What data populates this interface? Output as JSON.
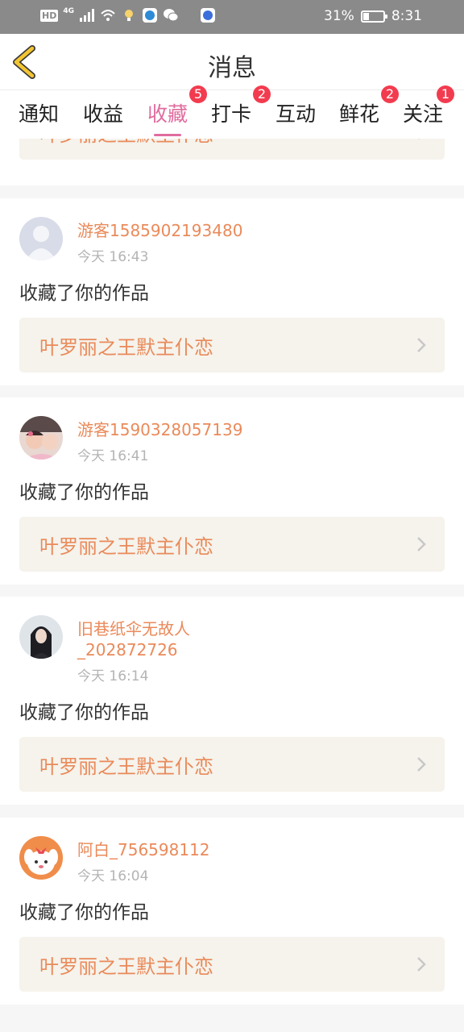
{
  "status_bar": {
    "network_badge": "HD",
    "signal": "4G",
    "battery": "31%",
    "battery_level": 0.31,
    "time": "8:31"
  },
  "header": {
    "title": "消息",
    "back_icon": "chevron-left-icon"
  },
  "tabs": [
    {
      "label": "通知",
      "badge": ""
    },
    {
      "label": "收益",
      "badge": ""
    },
    {
      "label": "收藏",
      "badge": "5",
      "active": true
    },
    {
      "label": "打卡",
      "badge": "2"
    },
    {
      "label": "互动",
      "badge": ""
    },
    {
      "label": "鲜花",
      "badge": "2"
    },
    {
      "label": "关注",
      "badge": "1"
    }
  ],
  "partial_card": {
    "work_title": "叶罗丽之王默主仆恋"
  },
  "messages": [
    {
      "username": "游客1585902193480",
      "time": "今天 16:43",
      "action": "收藏了你的作品",
      "work_title": "叶罗丽之王默主仆恋",
      "avatar": "default-avatar"
    },
    {
      "username": "游客1590328057139",
      "time": "今天 16:41",
      "action": "收藏了你的作品",
      "work_title": "叶罗丽之王默主仆恋",
      "avatar": "photo-children"
    },
    {
      "username": "旧巷纸伞无故人\n_202872726",
      "time": "今天 16:14",
      "action": "收藏了你的作品",
      "work_title": "叶罗丽之王默主仆恋",
      "avatar": "photo-girl"
    },
    {
      "username": "阿白_756598112",
      "time": "今天 16:04",
      "action": "收藏了你的作品",
      "work_title": "叶罗丽之王默主仆恋",
      "avatar": "cartoon-dog"
    }
  ],
  "colors": {
    "accent": "#e06c9f",
    "username": "#ea8a5a",
    "badge": "#f33b4f",
    "back_arrow": "#f3c533",
    "work_box": "#f5f3ec"
  }
}
